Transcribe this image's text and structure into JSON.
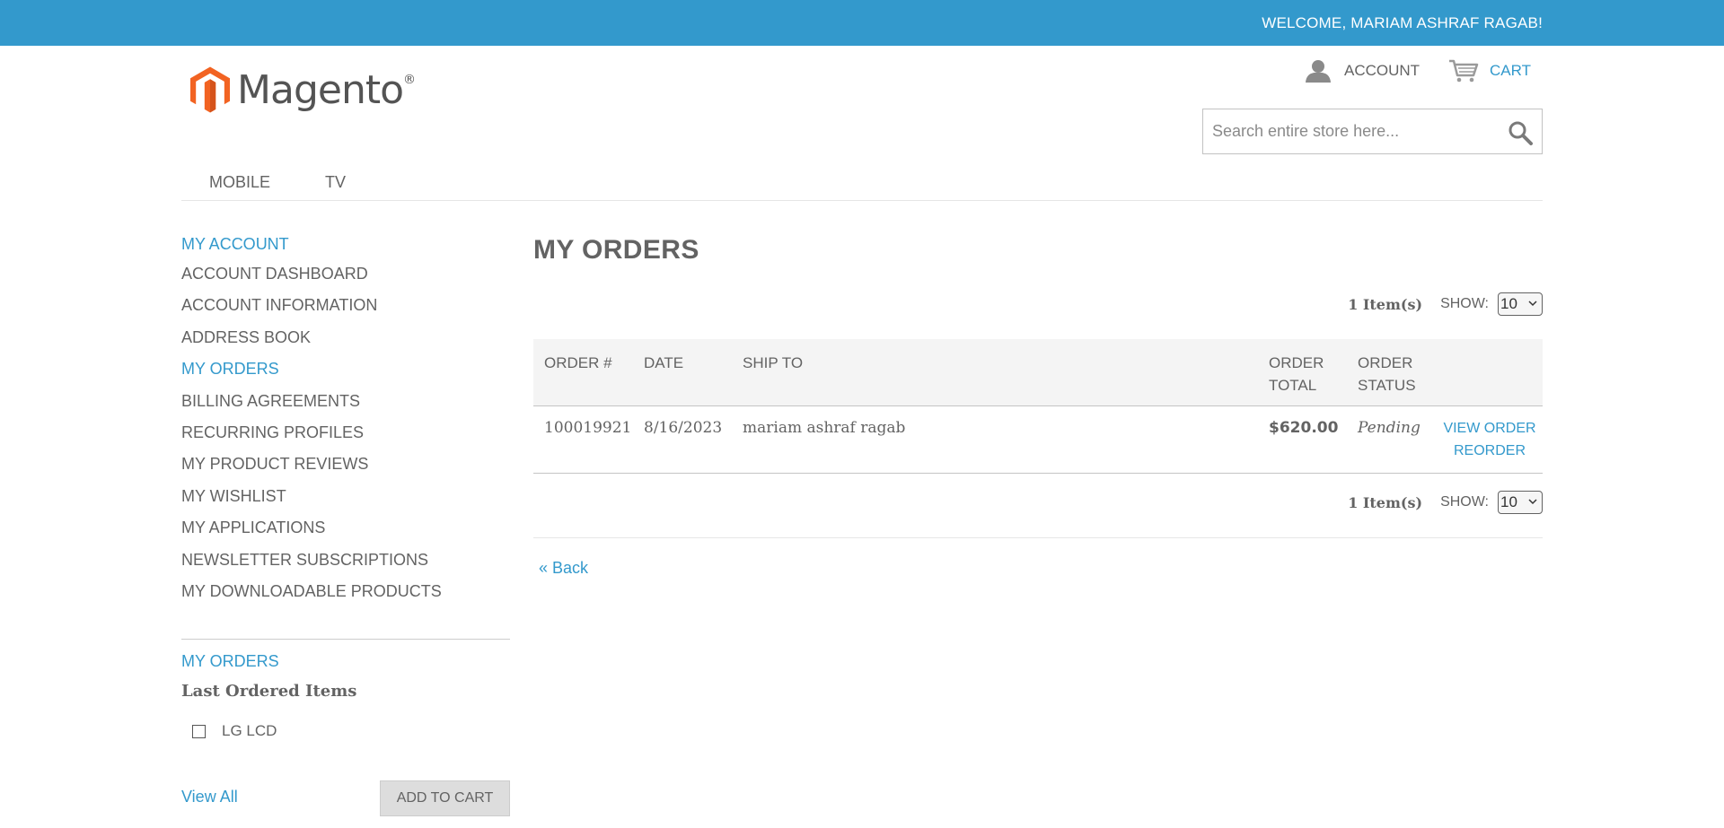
{
  "topbar": {
    "welcome": "WELCOME, MARIAM ASHRAF RAGAB!"
  },
  "header": {
    "logo_text": "Magento",
    "logo_mark": "®",
    "account_label": "ACCOUNT",
    "cart_label": "CART",
    "search_placeholder": "Search entire store here..."
  },
  "nav": {
    "items": [
      "MOBILE",
      "TV"
    ]
  },
  "sidebar": {
    "title": "MY ACCOUNT",
    "items": [
      "ACCOUNT DASHBOARD",
      "ACCOUNT INFORMATION",
      "ADDRESS BOOK",
      "MY ORDERS",
      "BILLING AGREEMENTS",
      "RECURRING PROFILES",
      "MY PRODUCT REVIEWS",
      "MY WISHLIST",
      "MY APPLICATIONS",
      "NEWSLETTER SUBSCRIPTIONS",
      "MY DOWNLOADABLE PRODUCTS"
    ],
    "active_item": "MY ORDERS",
    "orders_block": {
      "title": "MY ORDERS",
      "subtitle": "Last Ordered Items",
      "item": "LG LCD",
      "view_all": "View All",
      "add_to_cart": "ADD TO CART"
    }
  },
  "main": {
    "title": "MY ORDERS",
    "pager": {
      "count": "1 Item(s)",
      "show_label": "SHOW:",
      "show_value": "10"
    },
    "table": {
      "headers": {
        "order": "ORDER #",
        "date": "DATE",
        "ship_to": "SHIP TO",
        "total_1": "ORDER",
        "total_2": "TOTAL",
        "status_1": "ORDER",
        "status_2": "STATUS"
      },
      "rows": [
        {
          "order": "100019921",
          "date": "8/16/2023",
          "ship_to": "mariam ashraf ragab",
          "total": "$620.00",
          "status": "Pending",
          "view": "VIEW ORDER",
          "reorder": "REORDER"
        }
      ]
    },
    "back": "« Back"
  },
  "colors": {
    "brand_blue": "#3399cc",
    "text_gray": "#636363",
    "logo_orange": "#f26322"
  },
  "icons": {
    "account": "user-icon",
    "cart": "cart-icon",
    "search": "search-icon",
    "select": "chevron-down-icon"
  }
}
